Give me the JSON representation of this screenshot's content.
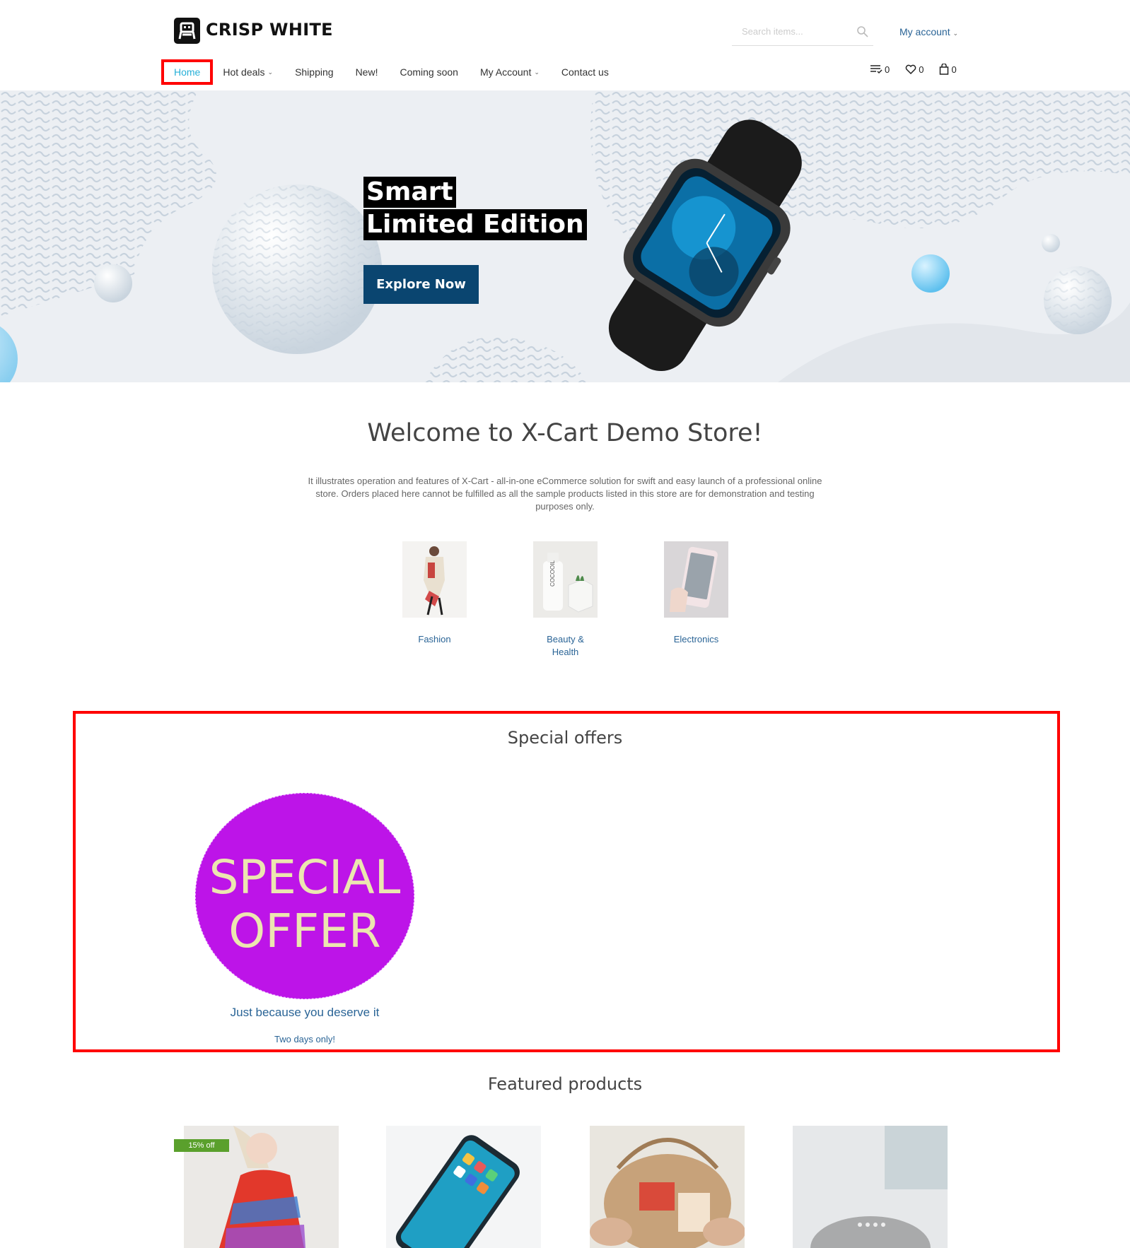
{
  "brand": {
    "name": "CRISP WHITE",
    "logo_icon": "cart-logo-icon"
  },
  "search": {
    "placeholder": "Search items..."
  },
  "account": {
    "label": "My account"
  },
  "nav": {
    "home": "Home",
    "hot_deals": "Hot deals",
    "shipping": "Shipping",
    "new": "New!",
    "coming_soon": "Coming soon",
    "my_account": "My Account",
    "contact": "Contact us"
  },
  "counters": {
    "compare": "0",
    "wishlist": "0",
    "cart": "0"
  },
  "hero": {
    "line1": "Smart",
    "line2": "Limited Edition",
    "button": "Explore Now"
  },
  "welcome": {
    "title": "Welcome to X-Cart Demo Store!",
    "text": "It illustrates operation and features of X-Cart - all-in-one eCommerce solution for swift and easy launch of a professional online store. Orders placed here cannot be fulfilled as all the sample products listed in this store are for demonstration and testing purposes only."
  },
  "categories": [
    {
      "label": "Fashion"
    },
    {
      "label": "Beauty & Health"
    },
    {
      "label": "Electronics"
    }
  ],
  "offers": {
    "title": "Special offers",
    "badge_line1": "SPECIAL",
    "badge_line2": "OFFER",
    "caption": "Just because you deserve it",
    "sub": "Two days only!"
  },
  "featured": {
    "title": "Featured products",
    "discount_badge": "15% off"
  },
  "colors": {
    "accent": "#27b0d8",
    "link": "#2a6496",
    "hero_button": "#0a4570",
    "offer_circle": "#bd14e8",
    "highlight": "#ff0000"
  }
}
